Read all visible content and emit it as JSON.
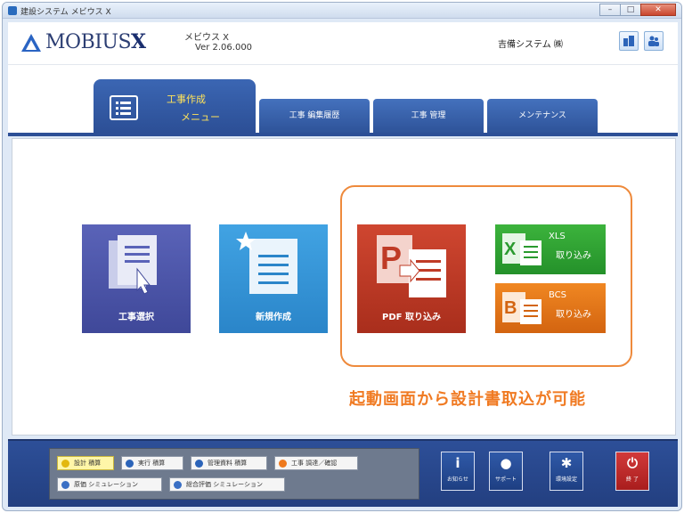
{
  "window": {
    "title": "建設システム メビウス X",
    "controls": [
      "–",
      "□",
      "✕"
    ]
  },
  "header": {
    "logo_text_main": "MOBIUS",
    "logo_text_x": "X",
    "product_name": "メビウス X",
    "version": "Ver 2.06.000",
    "company": "吉備システム ㈱"
  },
  "tabs": {
    "active": {
      "line1": "工事作成",
      "line2": "メニュー"
    },
    "items": [
      "工事 編集履歴",
      "工事 管理",
      "メンテナンス"
    ]
  },
  "tiles": {
    "select_label": "工事選択",
    "new_label": "新規作成",
    "pdf_label": "PDF 取り込み",
    "xls": {
      "line1": "XLS",
      "line2": "取り込み"
    },
    "bcs": {
      "line1": "BCS",
      "line2": "取り込み"
    }
  },
  "caption": "起動画面から設計書取込が可能",
  "footer": {
    "row1": [
      "設計 積算",
      "実行 積算",
      "管理資料 積算",
      "工事 調達／確認"
    ],
    "row2": [
      "原価 シミュレーション",
      "総合評価 シミュレーション"
    ],
    "actions": [
      {
        "icon": "i",
        "label": "お知らせ"
      },
      {
        "icon": "●",
        "label": "サポート"
      },
      {
        "icon": "✱",
        "label": "環境設定"
      },
      {
        "icon": "⏻",
        "label": "終 了"
      }
    ]
  },
  "colors": {
    "accent_blue": "#2c4f96",
    "highlight_orange": "#f07a22",
    "tile_select": "#4a53a8",
    "tile_new": "#3696d8",
    "tile_pdf": "#bf3b26",
    "tile_xls": "#2ea332",
    "tile_bcs": "#e27418"
  }
}
